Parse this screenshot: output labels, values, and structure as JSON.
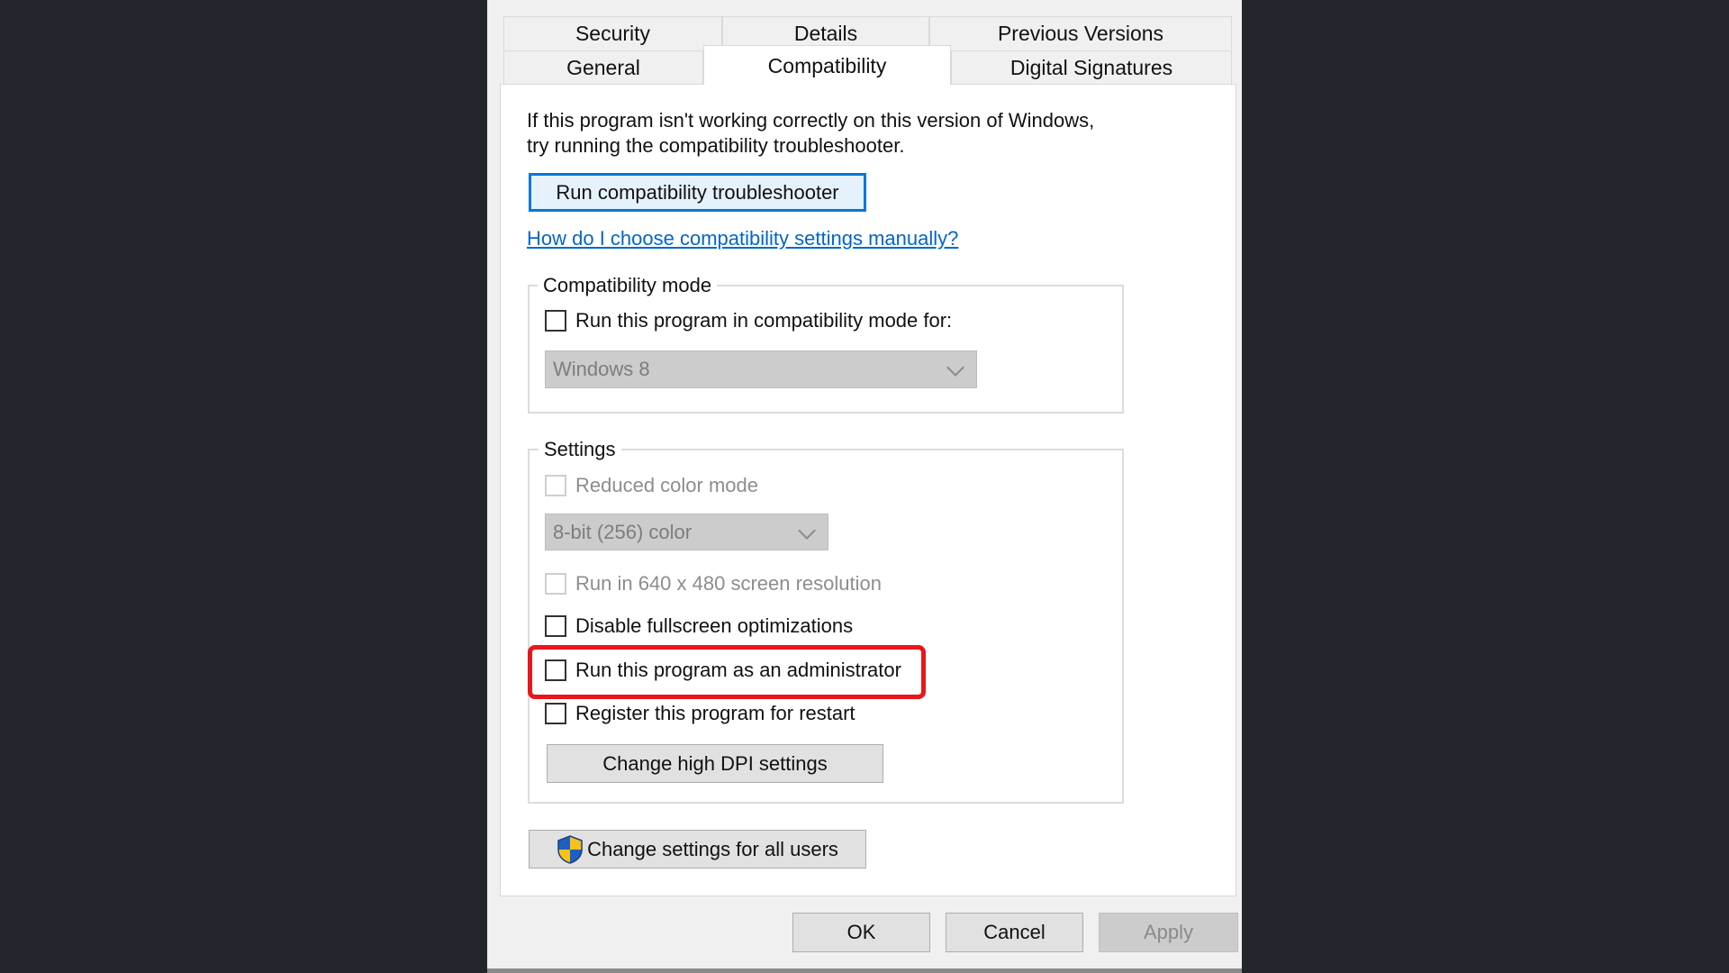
{
  "tabs": {
    "row1": [
      "Security",
      "Details",
      "Previous Versions"
    ],
    "row2": [
      "General",
      "Compatibility",
      "Digital Signatures"
    ],
    "active": "Compatibility"
  },
  "intro": {
    "line1": "If this program isn't working correctly on this version of Windows,",
    "line2": "try running the compatibility troubleshooter."
  },
  "troubleshooter_button": "Run compatibility troubleshooter",
  "help_link": "How do I choose compatibility settings manually?",
  "compat_mode": {
    "group_label": "Compatibility mode",
    "checkbox_label": "Run this program in compatibility mode for:",
    "checked": false,
    "selected_os": "Windows 8"
  },
  "settings": {
    "group_label": "Settings",
    "reduced_color": "Reduced color mode",
    "color_option": "8-bit (256) color",
    "res_640": "Run in 640 x 480 screen resolution",
    "disable_fullscreen": "Disable fullscreen optimizations",
    "run_admin": "Run this program as an administrator",
    "register_restart": "Register this program for restart",
    "dpi_button": "Change high DPI settings"
  },
  "all_users_button": "Change settings for all users",
  "footer": {
    "ok": "OK",
    "cancel": "Cancel",
    "apply": "Apply"
  },
  "colors": {
    "highlight": "#e8171a",
    "accent": "#0078d7",
    "link": "#0066cc"
  }
}
